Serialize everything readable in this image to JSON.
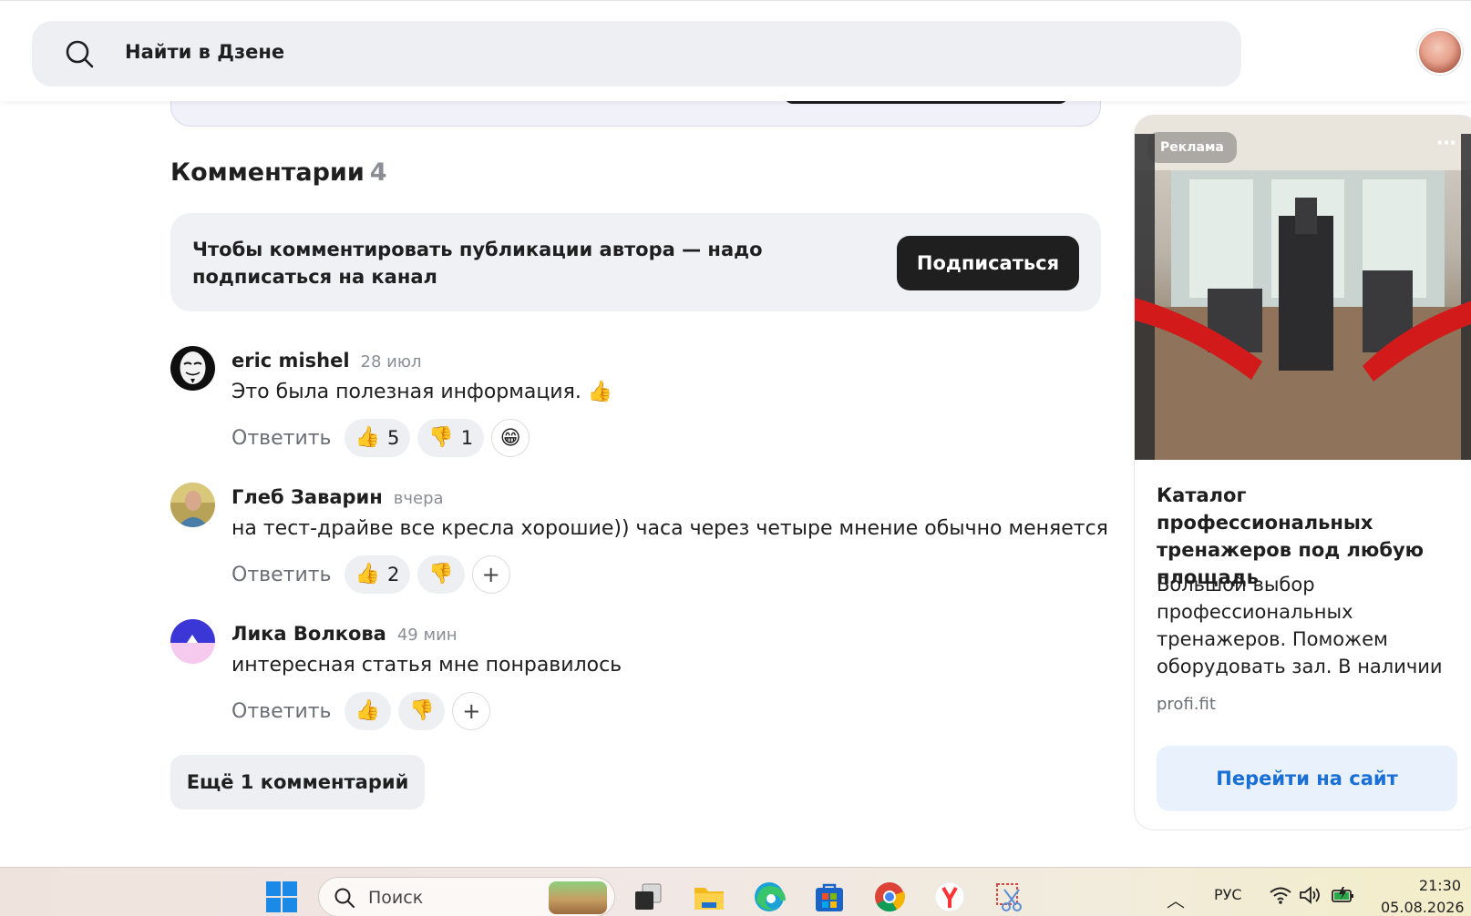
{
  "header": {
    "search_placeholder": "Найти в Дзене"
  },
  "comments_section": {
    "title": "Комментарии",
    "count": "4",
    "subscribe_notice": "Чтобы комментировать публикации автора — надо подписаться на канал",
    "subscribe_button": "Подписаться",
    "reply_label": "Ответить",
    "comments": [
      {
        "author": "eric mishel",
        "time": "28 июл",
        "text": "Это была полезная информация. 👍",
        "likes": "5",
        "dislikes": "1",
        "extra_reaction": "😁"
      },
      {
        "author": "Глеб Заварин",
        "time": "вчера",
        "text": "на тест-драйве все кресла хорошие)) часа через четыре мнение обычно меняется",
        "likes": "2",
        "dislikes": ""
      },
      {
        "author": "Лика Волкова",
        "time": "49 мин",
        "text": "интересная статья мне понравилось",
        "likes": "",
        "dislikes": ""
      }
    ],
    "more_button": "Ещё 1 комментарий"
  },
  "ad": {
    "badge": "Реклама",
    "more_icon": "⋯",
    "title": "Каталог профессиональных тренажеров под любую площадь",
    "description": "Большой выбор профессиональных тренажеров. Поможем оборудовать зал. В наличии",
    "domain": "profi.fit",
    "cta": "Перейти на сайт"
  },
  "taskbar": {
    "search_label": "Поиск",
    "language": "РУС",
    "time": "21:30",
    "date": "05.08.2026"
  },
  "icons": {
    "like": "👍",
    "dislike": "👎",
    "add": "+"
  },
  "colors": {
    "primary_dark": "#1f1f1f",
    "muted": "#8a8d93",
    "pill_bg": "#eeeff2",
    "cta_blue": "#1a6fd6",
    "cta_bg": "#e8f1fc"
  }
}
